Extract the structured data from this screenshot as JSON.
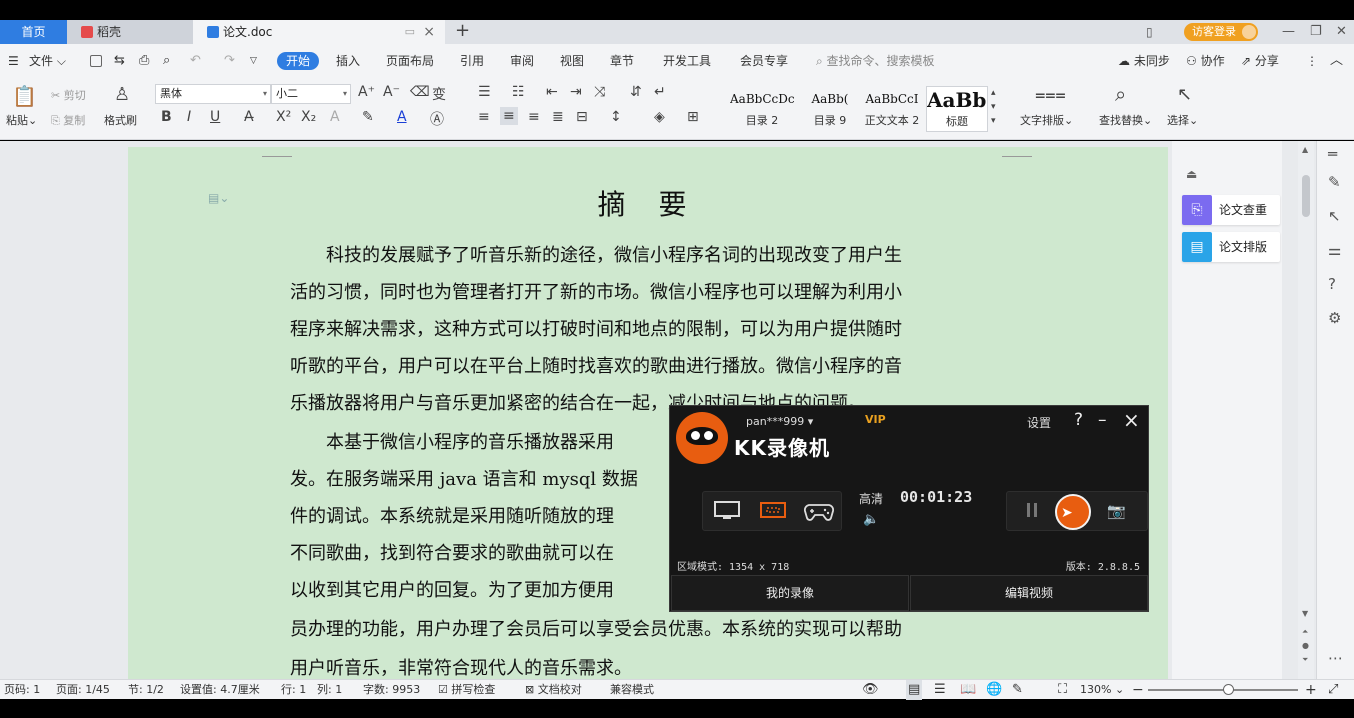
{
  "tabs": {
    "home": "首页",
    "daoke": "稻壳",
    "doc": "论文.doc",
    "add": "+",
    "visitor_login": "访客登录"
  },
  "menu": {
    "file": "文件",
    "start": "开始",
    "items": [
      "插入",
      "页面布局",
      "引用",
      "审阅",
      "视图",
      "章节",
      "开发工具",
      "会员专享"
    ],
    "search": "查找命令、搜索模板",
    "unsync": "未同步",
    "collab": "协作",
    "share": "分享"
  },
  "ribbon": {
    "paste": "粘贴",
    "cut": "剪切",
    "copy": "复制",
    "format_painter": "格式刷",
    "font_name": "黑体",
    "font_size": "小二",
    "styles": [
      {
        "preview": "AaBbCcDc",
        "label": "目录 2"
      },
      {
        "preview": "AaBb(",
        "label": "目录 9"
      },
      {
        "preview": "AaBbCcI",
        "label": "正文文本 2"
      },
      {
        "preview": "AaBb(",
        "label": "标题"
      }
    ],
    "text_layout": "文字排版",
    "find_replace": "查找替换",
    "select": "选择"
  },
  "document": {
    "title": "摘 要",
    "lines": [
      "　　科技的发展赋予了听音乐新的途径，微信小程序名词的出现改变了用户生",
      "活的习惯，同时也为管理者打开了新的市场。微信小程序也可以理解为利用小",
      "程序来解决需求，这种方式可以打破时间和地点的限制，可以为用户提供随时",
      "听歌的平台，用户可以在平台上随时找喜欢的歌曲进行播放。微信小程序的音",
      "乐播放器将用户与音乐更加紧密的结合在一起，减少时间与地点的问题。",
      "　　本基于微信小程序的音乐播放器采用",
      "发。在服务端采用 java 语言和 mysql 数据",
      "件的调试。本系统就是采用随听随放的理",
      "不同歌曲，找到符合要求的歌曲就可以在",
      "以收到其它用户的回复。为了更加方便用",
      "员办理的功能，用户办理了会员后可以享受会员优惠。本系统的实现可以帮助",
      "用户听音乐，非常符合现代人的音乐需求。"
    ]
  },
  "side_panel": {
    "check": "论文查重",
    "layout": "论文排版"
  },
  "status": {
    "page_no": "页码: 1",
    "pages": "页面: 1/45",
    "section": "节: 1/2",
    "setting": "设置值: 4.7厘米",
    "row": "行: 1",
    "col": "列: 1",
    "word_count": "字数: 9953",
    "spell": "拼写检查",
    "doc_check": "文档校对",
    "compat": "兼容模式",
    "zoom": "130%"
  },
  "recorder": {
    "user": "pan***999",
    "vip": "VIP",
    "name": "KK录像机",
    "settings": "设置",
    "help": "?",
    "minimize": "–",
    "close": "×",
    "quality": "高清",
    "time": "00:01:23",
    "region": "区域模式: 1354 x 718",
    "version": "版本: 2.8.8.5",
    "my_videos": "我的录像",
    "edit_video": "编辑视频"
  },
  "colors": {
    "accent": "#2f7de1",
    "page_bg": "#cfe8cf",
    "recorder_orange": "#e85d10",
    "vip_gold": "#e8a020"
  }
}
